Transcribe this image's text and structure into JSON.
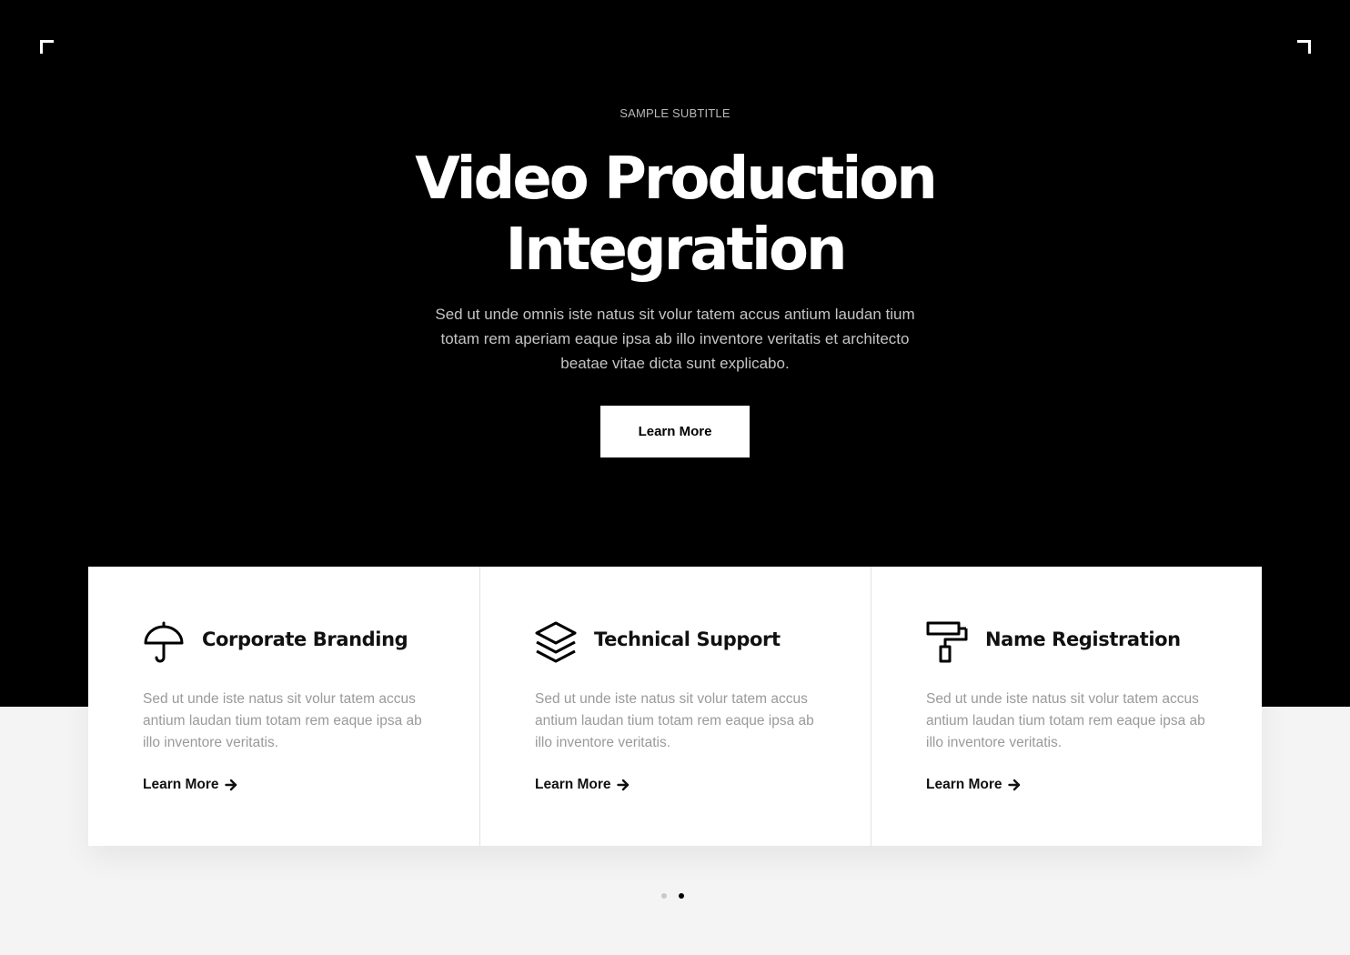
{
  "hero": {
    "subtitle": "SAMPLE SUBTITLE",
    "title_line1": "Video Production",
    "title_line2": "Integration",
    "description": "Sed ut unde omnis iste natus sit volur tatem accus antium laudan tium totam rem aperiam eaque ipsa ab illo inventore veritatis et architecto beatae vitae dicta sunt explicabo.",
    "button_label": "Learn More"
  },
  "cards": [
    {
      "icon": "umbrella-icon",
      "title": "Corporate Branding",
      "text": "Sed ut unde iste natus sit volur tatem accus antium laudan tium totam rem eaque ipsa ab illo inventore veritatis.",
      "link": "Learn More"
    },
    {
      "icon": "layers-icon",
      "title": "Technical Support",
      "text": "Sed ut unde iste natus sit volur tatem accus antium laudan tium totam rem eaque ipsa ab illo inventore veritatis.",
      "link": "Learn More"
    },
    {
      "icon": "paint-roller-icon",
      "title": "Name Registration",
      "text": "Sed ut unde iste natus sit volur tatem accus antium laudan tium totam rem eaque ipsa ab illo inventore veritatis.",
      "link": "Learn More"
    }
  ],
  "pagination": {
    "total": 2,
    "active_index": 1
  },
  "colors": {
    "hero_background": "#000000",
    "page_background": "#f4f4f4",
    "card_background": "#ffffff",
    "text_dark": "#111111",
    "text_muted": "#9a9a9a"
  }
}
